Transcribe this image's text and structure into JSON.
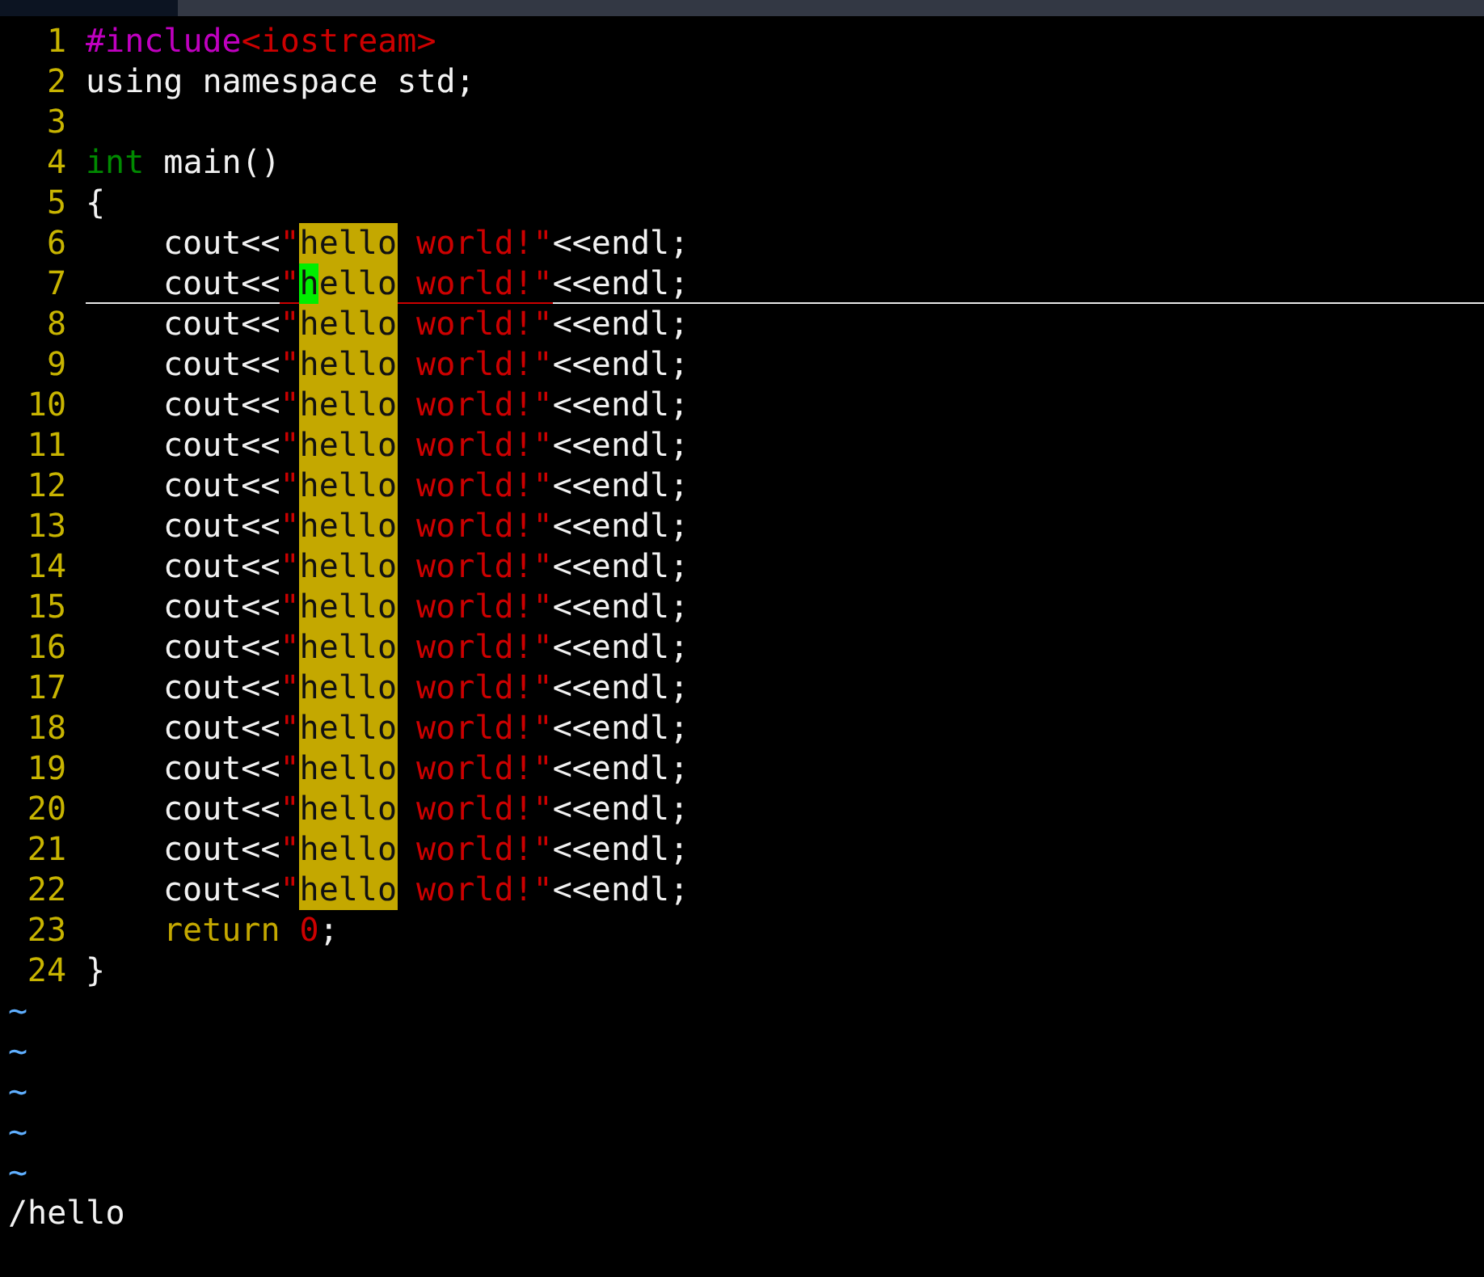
{
  "lines": [
    {
      "number": "1",
      "tokens": [
        {
          "kind": "preproc",
          "text": "#include"
        },
        {
          "kind": "string",
          "text": "<iostream>"
        }
      ]
    },
    {
      "number": "2",
      "tokens": [
        {
          "kind": "plain",
          "text": "using namespace std;"
        }
      ]
    },
    {
      "number": "3"
    },
    {
      "number": "4",
      "tokens": [
        {
          "kind": "type",
          "text": "int"
        },
        {
          "kind": "plain",
          "text": " main()"
        }
      ]
    },
    {
      "number": "5",
      "tokens": [
        {
          "kind": "plain",
          "text": "{"
        }
      ]
    },
    {
      "number": "6",
      "indented": true,
      "tokens": [
        {
          "kind": "plain",
          "text": "cout<<"
        },
        {
          "kind": "string",
          "text": "\""
        },
        {
          "kind": "search",
          "text": "hello"
        },
        {
          "kind": "string",
          "text": " world!\""
        },
        {
          "kind": "plain",
          "text": "<<endl;"
        }
      ]
    },
    {
      "number": "7",
      "indented": true,
      "cursorline": true,
      "tokens": [
        {
          "kind": "plain",
          "text": "cout<<"
        },
        {
          "kind": "string",
          "text": "\""
        },
        {
          "kind": "cursor",
          "text": "h"
        },
        {
          "kind": "search",
          "text": "ello"
        },
        {
          "kind": "string",
          "text": " world!\""
        },
        {
          "kind": "plain",
          "text": "<<endl;"
        }
      ]
    },
    {
      "number": "8",
      "indented": true,
      "tokens": [
        {
          "kind": "plain",
          "text": "cout<<"
        },
        {
          "kind": "string",
          "text": "\""
        },
        {
          "kind": "search",
          "text": "hello"
        },
        {
          "kind": "string",
          "text": " world!\""
        },
        {
          "kind": "plain",
          "text": "<<endl;"
        }
      ]
    },
    {
      "number": "9",
      "indented": true,
      "tokens": [
        {
          "kind": "plain",
          "text": "cout<<"
        },
        {
          "kind": "string",
          "text": "\""
        },
        {
          "kind": "search",
          "text": "hello"
        },
        {
          "kind": "string",
          "text": " world!\""
        },
        {
          "kind": "plain",
          "text": "<<endl;"
        }
      ]
    },
    {
      "number": "10",
      "indented": true,
      "tokens": [
        {
          "kind": "plain",
          "text": "cout<<"
        },
        {
          "kind": "string",
          "text": "\""
        },
        {
          "kind": "search",
          "text": "hello"
        },
        {
          "kind": "string",
          "text": " world!\""
        },
        {
          "kind": "plain",
          "text": "<<endl;"
        }
      ]
    },
    {
      "number": "11",
      "indented": true,
      "tokens": [
        {
          "kind": "plain",
          "text": "cout<<"
        },
        {
          "kind": "string",
          "text": "\""
        },
        {
          "kind": "search",
          "text": "hello"
        },
        {
          "kind": "string",
          "text": " world!\""
        },
        {
          "kind": "plain",
          "text": "<<endl;"
        }
      ]
    },
    {
      "number": "12",
      "indented": true,
      "tokens": [
        {
          "kind": "plain",
          "text": "cout<<"
        },
        {
          "kind": "string",
          "text": "\""
        },
        {
          "kind": "search",
          "text": "hello"
        },
        {
          "kind": "string",
          "text": " world!\""
        },
        {
          "kind": "plain",
          "text": "<<endl;"
        }
      ]
    },
    {
      "number": "13",
      "indented": true,
      "tokens": [
        {
          "kind": "plain",
          "text": "cout<<"
        },
        {
          "kind": "string",
          "text": "\""
        },
        {
          "kind": "search",
          "text": "hello"
        },
        {
          "kind": "string",
          "text": " world!\""
        },
        {
          "kind": "plain",
          "text": "<<endl;"
        }
      ]
    },
    {
      "number": "14",
      "indented": true,
      "tokens": [
        {
          "kind": "plain",
          "text": "cout<<"
        },
        {
          "kind": "string",
          "text": "\""
        },
        {
          "kind": "search",
          "text": "hello"
        },
        {
          "kind": "string",
          "text": " world!\""
        },
        {
          "kind": "plain",
          "text": "<<endl;"
        }
      ]
    },
    {
      "number": "15",
      "indented": true,
      "tokens": [
        {
          "kind": "plain",
          "text": "cout<<"
        },
        {
          "kind": "string",
          "text": "\""
        },
        {
          "kind": "search",
          "text": "hello"
        },
        {
          "kind": "string",
          "text": " world!\""
        },
        {
          "kind": "plain",
          "text": "<<endl;"
        }
      ]
    },
    {
      "number": "16",
      "indented": true,
      "tokens": [
        {
          "kind": "plain",
          "text": "cout<<"
        },
        {
          "kind": "string",
          "text": "\""
        },
        {
          "kind": "search",
          "text": "hello"
        },
        {
          "kind": "string",
          "text": " world!\""
        },
        {
          "kind": "plain",
          "text": "<<endl;"
        }
      ]
    },
    {
      "number": "17",
      "indented": true,
      "tokens": [
        {
          "kind": "plain",
          "text": "cout<<"
        },
        {
          "kind": "string",
          "text": "\""
        },
        {
          "kind": "search",
          "text": "hello"
        },
        {
          "kind": "string",
          "text": " world!\""
        },
        {
          "kind": "plain",
          "text": "<<endl;"
        }
      ]
    },
    {
      "number": "18",
      "indented": true,
      "tokens": [
        {
          "kind": "plain",
          "text": "cout<<"
        },
        {
          "kind": "string",
          "text": "\""
        },
        {
          "kind": "search",
          "text": "hello"
        },
        {
          "kind": "string",
          "text": " world!\""
        },
        {
          "kind": "plain",
          "text": "<<endl;"
        }
      ]
    },
    {
      "number": "19",
      "indented": true,
      "tokens": [
        {
          "kind": "plain",
          "text": "cout<<"
        },
        {
          "kind": "string",
          "text": "\""
        },
        {
          "kind": "search",
          "text": "hello"
        },
        {
          "kind": "string",
          "text": " world!\""
        },
        {
          "kind": "plain",
          "text": "<<endl;"
        }
      ]
    },
    {
      "number": "20",
      "indented": true,
      "tokens": [
        {
          "kind": "plain",
          "text": "cout<<"
        },
        {
          "kind": "string",
          "text": "\""
        },
        {
          "kind": "search",
          "text": "hello"
        },
        {
          "kind": "string",
          "text": " world!\""
        },
        {
          "kind": "plain",
          "text": "<<endl;"
        }
      ]
    },
    {
      "number": "21",
      "indented": true,
      "tokens": [
        {
          "kind": "plain",
          "text": "cout<<"
        },
        {
          "kind": "string",
          "text": "\""
        },
        {
          "kind": "search",
          "text": "hello"
        },
        {
          "kind": "string",
          "text": " world!\""
        },
        {
          "kind": "plain",
          "text": "<<endl;"
        }
      ]
    },
    {
      "number": "22",
      "indented": true,
      "tokens": [
        {
          "kind": "plain",
          "text": "cout<<"
        },
        {
          "kind": "string",
          "text": "\""
        },
        {
          "kind": "search",
          "text": "hello"
        },
        {
          "kind": "string",
          "text": " world!\""
        },
        {
          "kind": "plain",
          "text": "<<endl;"
        }
      ]
    },
    {
      "number": "23",
      "indented": true,
      "tokens": [
        {
          "kind": "statement",
          "text": "return"
        },
        {
          "kind": "number",
          "text": " 0"
        },
        {
          "kind": "plain",
          "text": ";"
        }
      ]
    },
    {
      "number": "24",
      "tokens": [
        {
          "kind": "plain",
          "text": "}"
        }
      ]
    }
  ],
  "empty_lines": [
    "~",
    "~",
    "~",
    "~",
    "~"
  ],
  "command_line": "/hello"
}
